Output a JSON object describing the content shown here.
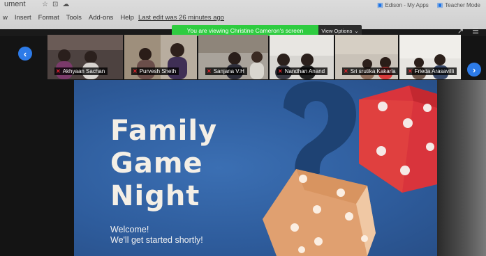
{
  "document": {
    "title_fragment": "ument",
    "icons": [
      "star-icon",
      "move-to-folder-icon",
      "cloud-status-icon"
    ],
    "menu": [
      "w",
      "Insert",
      "Format",
      "Tools",
      "Add-ons",
      "Help"
    ],
    "last_edit": "Last edit was 26 minutes ago"
  },
  "browser_tabs": [
    {
      "label": "Edison - My Apps",
      "icon": "app-icon"
    },
    {
      "label": "Teacher Mode",
      "icon": "app-icon"
    }
  ],
  "share_banner": {
    "message": "You are viewing Christine Cameron's screen",
    "options_label": "View Options",
    "options_icon": "chevron-down-icon",
    "banner_color": "#2ecc40"
  },
  "participants": [
    {
      "name": "Akhyaan Sachan",
      "muted": true
    },
    {
      "name": "Purvesh Sheth",
      "muted": true
    },
    {
      "name": "Sanjana V.H",
      "muted": true
    },
    {
      "name": "Nandhan Anand",
      "muted": true
    },
    {
      "name": "Sri srutika Kakarla",
      "muted": true
    },
    {
      "name": "Frieda Arasavilli",
      "muted": true
    }
  ],
  "navigation": {
    "prev_icon": "chevron-left-icon",
    "next_icon": "chevron-right-icon",
    "accent": "#2d7be8"
  },
  "slide": {
    "title_lines": [
      "Family",
      "Game",
      "Night"
    ],
    "subtitle_lines": [
      "Welcome!",
      "We'll get started shortly!"
    ],
    "background": "#2e5c9c",
    "red_die": "#d9343c",
    "orange_die": "#e0a070",
    "question_mark": "#1e4273"
  },
  "colors": {
    "muted_mic": "#e8242c"
  }
}
